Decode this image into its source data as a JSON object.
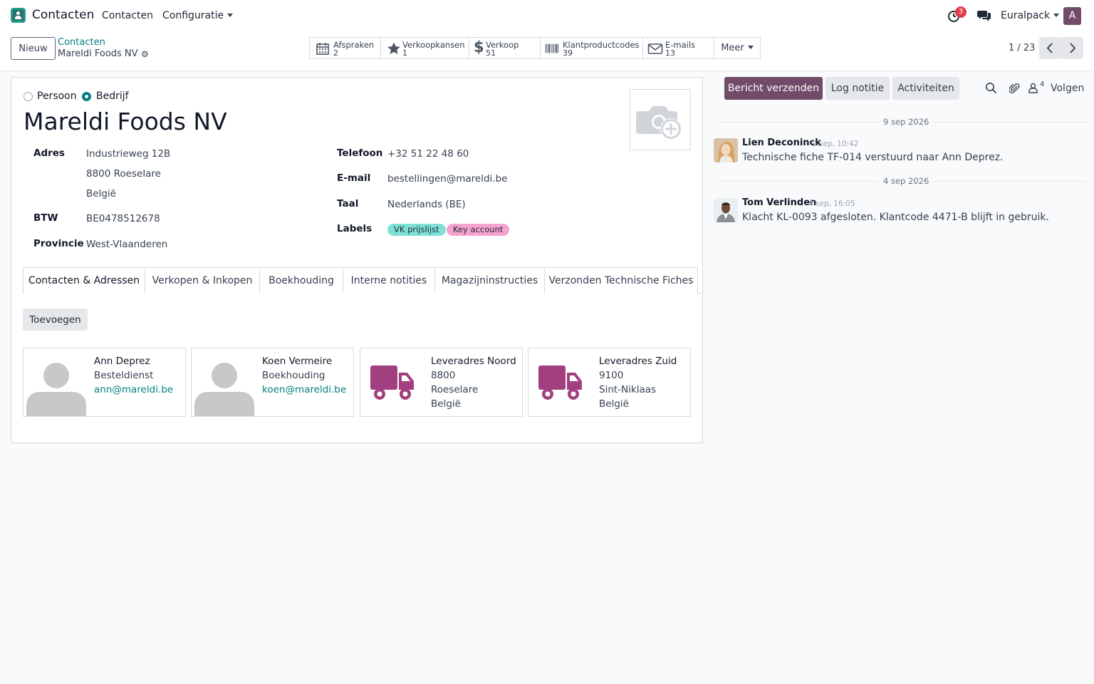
{
  "navbar": {
    "app_name": "Contacten",
    "menu_contacts": "Contacten",
    "menu_config": "Configuratie",
    "activity_count": "3",
    "company": "Euralpack",
    "user_initial": "A"
  },
  "control": {
    "new_label": "Nieuw",
    "breadcrumb_parent": "Contacten",
    "breadcrumb_current": "Mareldi Foods NV",
    "smart_buttons": [
      {
        "label": "Afspraken",
        "count": "2",
        "icon": "calendar-icon"
      },
      {
        "label": "Verkoopkansen",
        "count": "1",
        "icon": "star-icon"
      },
      {
        "label": "Verkoop",
        "count": "51",
        "icon": "dollar-icon"
      },
      {
        "label": "Klantproductcodes",
        "count": "39",
        "icon": "barcode-icon"
      },
      {
        "label": "E-mails",
        "count": "13",
        "icon": "envelope-icon"
      }
    ],
    "more_label": "Meer",
    "pager": "1 / 23"
  },
  "form": {
    "type_person": "Persoon",
    "type_company": "Bedrijf",
    "name": "Mareldi Foods NV",
    "labels": {
      "address": "Adres",
      "vat": "BTW",
      "province": "Provincie",
      "phone": "Telefoon",
      "email": "E-mail",
      "language": "Taal",
      "tags": "Labels"
    },
    "address_line1": "Industrieweg 12B",
    "address_line2": "8800 Roeselare",
    "address_line3": "België",
    "vat": "BE0478512678",
    "province": "West-Vlaanderen",
    "phone": "+32 51 22 48 60",
    "email": "bestellingen@mareldi.be",
    "language": "Nederlands (BE)",
    "tags": [
      {
        "label": "VK prijslijst",
        "color": "#7ee0d6"
      },
      {
        "label": "Key account",
        "color": "#f7a3d0"
      }
    ]
  },
  "tabs": [
    "Contacten & Adressen",
    "Verkopen & Inkopen",
    "Boekhouding",
    "Interne notities",
    "Magazijninstructies",
    "Verzonden Technische Fiches"
  ],
  "add_label": "Toevoegen",
  "cards": [
    {
      "l1": "Ann Deprez",
      "l2": "Besteldienst",
      "l3": "ann@mareldi.be",
      "l4": "",
      "kind": "person"
    },
    {
      "l1": "Koen Vermeire",
      "l2": "Boekhouding",
      "l3": "koen@mareldi.be",
      "l4": "",
      "kind": "person"
    },
    {
      "l1": "Leveradres Noord",
      "l2": "8800",
      "l3": "Roeselare",
      "l4": "België",
      "kind": "delivery"
    },
    {
      "l1": "Leveradres Zuid",
      "l2": "9100",
      "l3": "Sint-Niklaas",
      "l4": "België",
      "kind": "delivery"
    }
  ],
  "chatter": {
    "send_message": "Bericht verzenden",
    "log_note": "Log notitie",
    "activities": "Activiteiten",
    "followers_count": "4",
    "follow": "Volgen",
    "messages": [
      {
        "date": "9 sep 2026",
        "author": "Lien Deconinck",
        "time": "9 sep, 10:42",
        "body": "Technische fiche TF-014 verstuurd naar Ann Deprez."
      },
      {
        "date": "4 sep 2026",
        "author": "Tom Verlinden",
        "time": "4 sep, 16:05",
        "body": "Klacht KL-0093 afgesloten. Klantcode 4471-B blijft in gebruik."
      }
    ]
  },
  "colors": {
    "accent": "#714b67",
    "link": "#017e84",
    "delivery_icon": "#a2407f",
    "badge": "#e03e4d"
  }
}
